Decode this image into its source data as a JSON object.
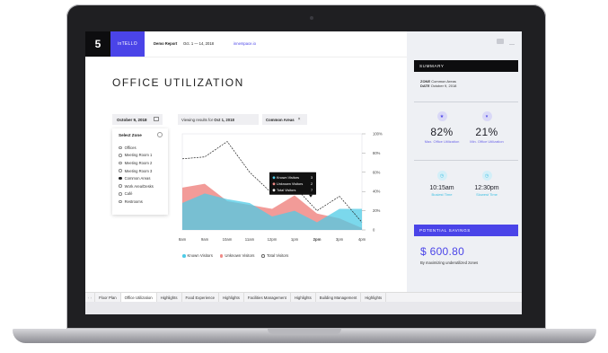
{
  "topbar": {
    "logo": "5",
    "brand": "inTELLO",
    "report_label": "Demo Report",
    "date_range": "Oct. 1 — 14, 2018",
    "link": "innerspace.io"
  },
  "main": {
    "title": "OFFICE UTILIZATION",
    "date": "October 9, 2018",
    "viewing_prefix": "Viewing results for",
    "viewing_date": "Oct 1, 2018",
    "filter_chip": "Common Areas",
    "filter_chip_close": "×"
  },
  "zone_panel": {
    "title": "Select Zone",
    "items": [
      {
        "label": "Offices",
        "selected": false
      },
      {
        "label": "Meeting Room 1",
        "selected": false
      },
      {
        "label": "Meeting Room 2",
        "selected": false
      },
      {
        "label": "Meeting Room 3",
        "selected": false
      },
      {
        "label": "Common Areas",
        "selected": true
      },
      {
        "label": "Work Area/Desks",
        "selected": false
      },
      {
        "label": "Café",
        "selected": false
      },
      {
        "label": "Restrooms",
        "selected": false
      }
    ]
  },
  "chart_data": {
    "type": "area",
    "categories": [
      "8am",
      "9am",
      "10am",
      "11am",
      "12pm",
      "1pm",
      "2pm",
      "3pm",
      "4pm"
    ],
    "y_tick_labels": [
      "100%",
      "80%",
      "60%",
      "40%",
      "20%",
      "0"
    ],
    "ylim": [
      0,
      100
    ],
    "series": [
      {
        "name": "Known Visitors",
        "color": "#4fcbe6",
        "values": [
          28,
          38,
          32,
          28,
          14,
          20,
          8,
          22,
          22
        ]
      },
      {
        "name": "Unknown Visitors",
        "color": "#f08a86",
        "values": [
          44,
          48,
          30,
          26,
          22,
          36,
          17,
          12,
          2
        ]
      },
      {
        "name": "Total Visitors",
        "color": "#222222",
        "values": [
          74,
          76,
          92,
          60,
          38,
          45,
          20,
          35,
          8
        ]
      }
    ],
    "tooltip": {
      "rows": [
        {
          "label": "Known Visitors",
          "value": "3"
        },
        {
          "label": "Unknown Visitors",
          "value": "2"
        },
        {
          "label": "Total Visitors",
          "value": "7"
        }
      ]
    }
  },
  "summary": {
    "header": "SUMMARY",
    "zone_key": "ZONE",
    "zone_value": "Common Areas",
    "date_key": "DATE",
    "date_value": "October 9, 2018",
    "max_util": "82%",
    "max_util_label": "Max. Office Utilization",
    "min_util": "21%",
    "min_util_label": "Min. Office Utilization",
    "busiest": "10:15am",
    "busiest_label": "Busiest Time",
    "slowest": "12:30pm",
    "slowest_label": "Slowest Time",
    "savings_header": "POTENTIAL SAVINGS",
    "savings_amount": "$ 600.80",
    "savings_note": "By maximizing underutilized zones"
  },
  "tabs": {
    "arrows": "‹ ›",
    "items": [
      {
        "label": "Floor Plan",
        "active": false
      },
      {
        "label": "Office Utilization",
        "active": true
      },
      {
        "label": "Highlights",
        "active": false
      },
      {
        "label": "Food Experience",
        "active": false
      },
      {
        "label": "Highlights",
        "active": false
      },
      {
        "label": "Facilities Management",
        "active": false
      },
      {
        "label": "Highlights",
        "active": false
      },
      {
        "label": "Building Management",
        "active": false
      },
      {
        "label": "Highlights",
        "active": false
      }
    ]
  },
  "colors": {
    "accent": "#4a44e8",
    "known": "#4fcbe6",
    "unknown": "#f08a86"
  }
}
